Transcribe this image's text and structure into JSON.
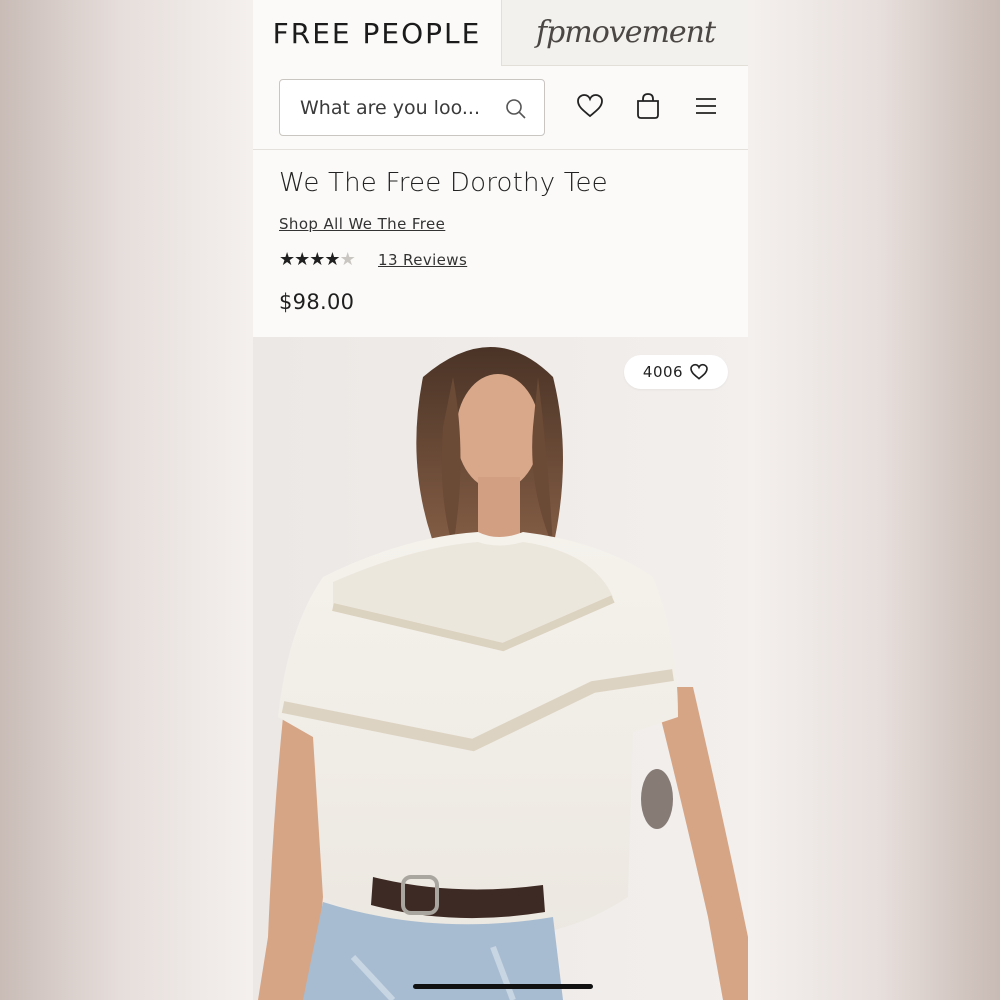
{
  "brand": {
    "primary": "FREE PEOPLE",
    "secondary": "fpmovement"
  },
  "search": {
    "placeholder": "What are you loo..."
  },
  "header_icons": [
    "search-icon",
    "heart-icon",
    "bag-icon",
    "menu-icon"
  ],
  "product": {
    "title": "We The Free Dorothy Tee",
    "shop_all": "Shop All We The Free",
    "rating": 4,
    "rating_max": 5,
    "reviews": "13 Reviews",
    "price": "$98.00",
    "favorites_count": "4006"
  },
  "colors": {
    "background": "#fbfaf8",
    "text": "#1f1f1f",
    "star": "#1f1f1f"
  }
}
